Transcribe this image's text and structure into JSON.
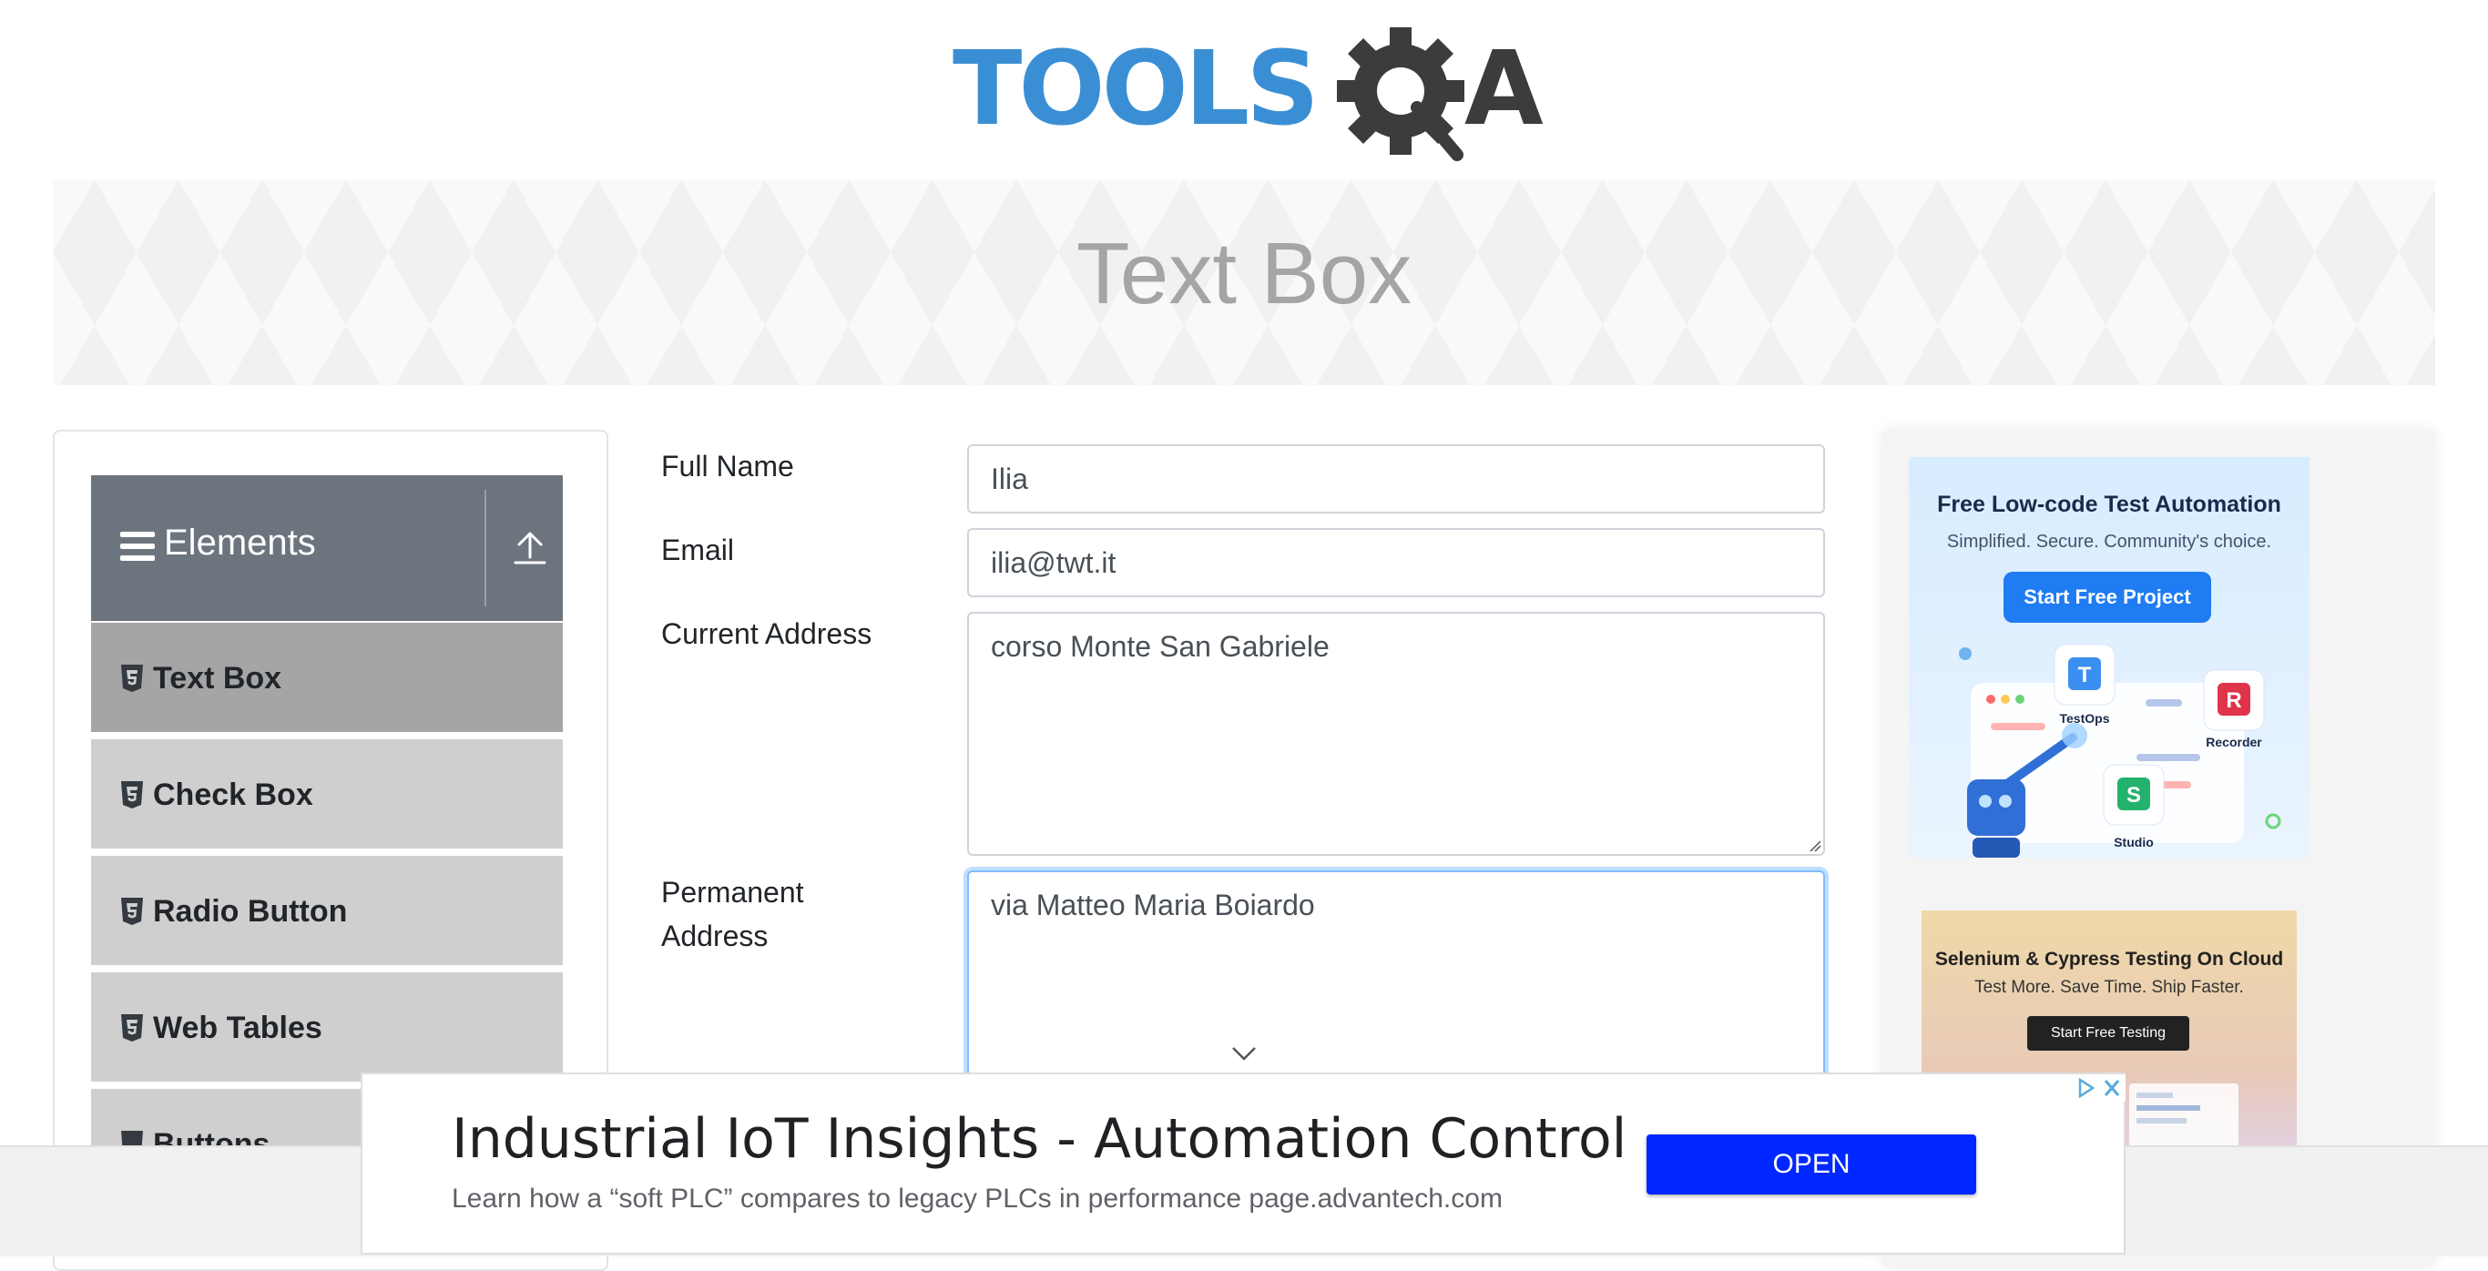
{
  "header": {
    "logo_text": "TOOLSQA"
  },
  "banner": {
    "title": "Text Box"
  },
  "sidebar": {
    "group_title": "Elements",
    "items": [
      {
        "label": "Text Box",
        "active": true
      },
      {
        "label": "Check Box",
        "active": false
      },
      {
        "label": "Radio Button",
        "active": false
      },
      {
        "label": "Web Tables",
        "active": false
      },
      {
        "label": "Buttons",
        "active": false
      }
    ]
  },
  "form": {
    "full_name": {
      "label": "Full Name",
      "value": "Ilia"
    },
    "email": {
      "label": "Email",
      "value": "ilia@twt.it"
    },
    "current_address": {
      "label": "Current Address",
      "value": "corso Monte San Gabriele"
    },
    "permanent_address": {
      "label_line1": "Permanent",
      "label_line2": "Address",
      "value": "via Matteo Maria Boiardo"
    }
  },
  "ads": {
    "side_ad_1": {
      "title": "Free Low-code Test Automation",
      "subtitle": "Simplified. Secure. Community's choice.",
      "button": "Start Free Project",
      "products": [
        "TestOps",
        "Recorder",
        "Studio"
      ]
    },
    "side_ad_2": {
      "title": "Selenium & Cypress Testing On Cloud",
      "subtitle": "Test More. Save Time. Ship Faster.",
      "button": "Start Free Testing"
    },
    "bottom_ad": {
      "headline": "Industrial IoT Insights - Automation Control",
      "description": "Learn how a “soft PLC” compares to legacy PLCs in performance page.advantech.com",
      "button": "OPEN"
    }
  },
  "colors": {
    "logo_blue": "#3a8fd4",
    "logo_dark": "#3c3c3c",
    "sidebar_header": "#6c757d",
    "menu_item": "#cfcfcf",
    "menu_item_active": "#a5a5a5",
    "focus_border": "#80bdff",
    "ad_open_button": "#0027ff"
  }
}
